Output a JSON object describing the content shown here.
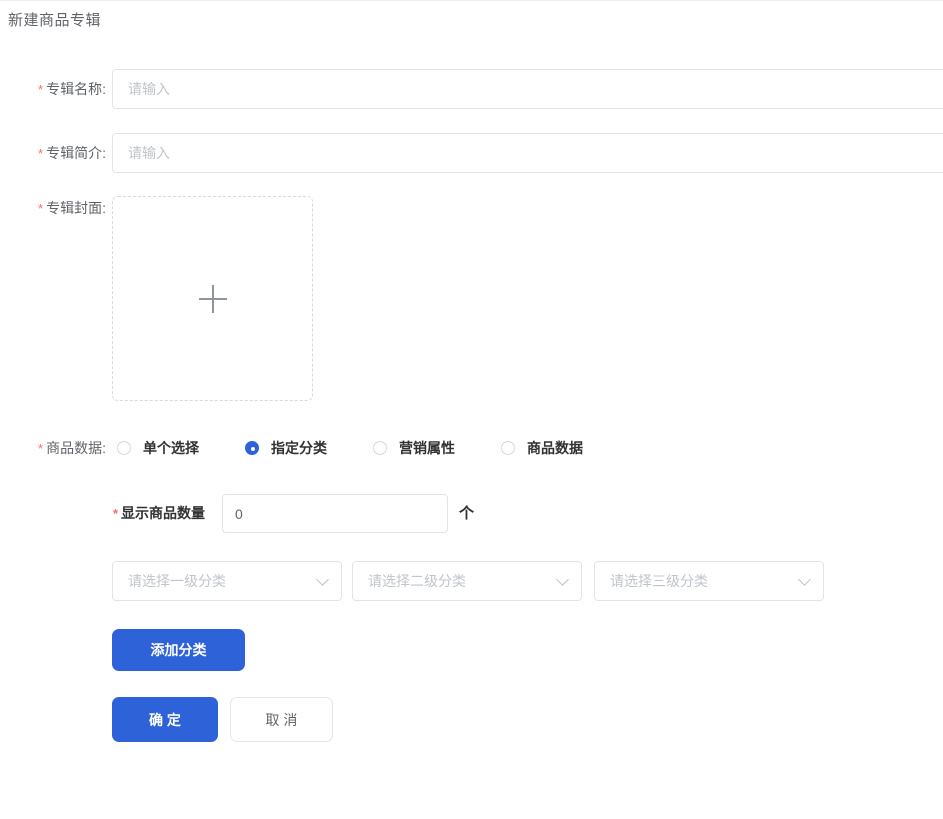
{
  "colors": {
    "accent_blue": "#2e62d9",
    "required_red": "#f56c6c",
    "label_gray": "#5f6368",
    "strong_text": "#303133",
    "placeholder_gray": "#c0c4cc",
    "input_border": "#e0e4ea"
  },
  "page": {
    "title": "新建商品专辑"
  },
  "form": {
    "required_mark": "*",
    "album_name": {
      "label": "专辑名称:",
      "placeholder": "请输入"
    },
    "album_intro": {
      "label": "专辑简介:",
      "placeholder": "请输入"
    },
    "album_cover": {
      "label": "专辑封面:"
    },
    "product_data": {
      "label": "商品数据:",
      "options": [
        {
          "label": "单个选择",
          "selected": false
        },
        {
          "label": "指定分类",
          "selected": true
        },
        {
          "label": "营销属性",
          "selected": false
        },
        {
          "label": "商品数据",
          "selected": false
        }
      ]
    },
    "display_count": {
      "label": "显示商品数量",
      "value": "0",
      "unit": "个"
    },
    "category_selects": [
      {
        "placeholder": "请选择一级分类"
      },
      {
        "placeholder": "请选择二级分类"
      },
      {
        "placeholder": "请选择三级分类"
      }
    ],
    "add_category_button": "添加分类",
    "confirm_button": "确 定",
    "cancel_button": "取 消"
  }
}
